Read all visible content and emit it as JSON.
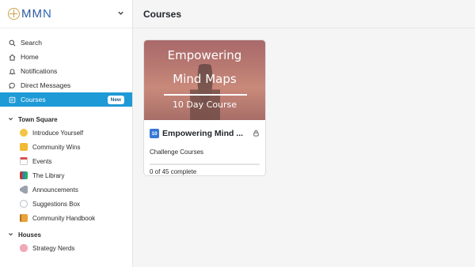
{
  "brand": {
    "name_part1": "MM",
    "name_part2": "N"
  },
  "nav": [
    {
      "label": "Search",
      "icon": "search-icon"
    },
    {
      "label": "Home",
      "icon": "home-icon"
    },
    {
      "label": "Notifications",
      "icon": "bell-icon"
    },
    {
      "label": "Direct Messages",
      "icon": "chat-bubble-icon"
    },
    {
      "label": "Courses",
      "icon": "courses-icon",
      "badge": "New",
      "active": true
    }
  ],
  "sections": [
    {
      "title": "Town Square",
      "items": [
        {
          "label": "Introduce Yourself",
          "icon": "wave-hand-icon"
        },
        {
          "label": "Community Wins",
          "icon": "raised-hands-icon"
        },
        {
          "label": "Events",
          "icon": "calendar-icon"
        },
        {
          "label": "The Library",
          "icon": "books-icon"
        },
        {
          "label": "Announcements",
          "icon": "megaphone-icon"
        },
        {
          "label": "Suggestions Box",
          "icon": "speech-bubble-icon"
        },
        {
          "label": "Community Handbook",
          "icon": "notebook-icon"
        }
      ]
    },
    {
      "title": "Houses",
      "items": [
        {
          "label": "Strategy Nerds",
          "icon": "brain-icon"
        }
      ]
    }
  ],
  "main": {
    "title": "Courses",
    "course": {
      "cover_line1": "Empowering",
      "cover_line2": "Mind Maps",
      "cover_line3": "10 Day Course",
      "number_badge": "10",
      "title": "Empowering Mind ...",
      "category": "Challenge Courses",
      "progress": 0,
      "status": "0 of 45 complete"
    }
  },
  "colors": {
    "accent": "#1e9ad6",
    "brand": "#2d5aa0"
  }
}
